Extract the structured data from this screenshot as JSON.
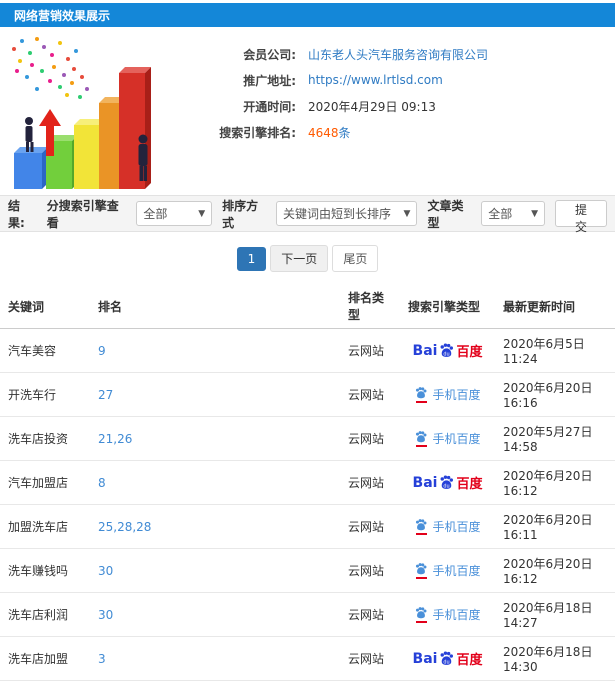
{
  "colors": {
    "header_bg": "#1487d8",
    "link_blue": "#2f7bc3",
    "rank_link_blue": "#418bd4",
    "count_orange": "#ff5a00",
    "baidu_blue": "#2540d8",
    "baidu_red": "#e2001a",
    "mobile_baidu_blue": "#4a90d9",
    "active_page_blue": "#2e75b5"
  },
  "header": {
    "title": "网络营销效果展示"
  },
  "info": {
    "rows": [
      {
        "label": "会员公司:",
        "value": "山东老人头汽车服务咨询有限公司"
      },
      {
        "label": "推广地址:",
        "value": "https://www.lrtlsd.com"
      },
      {
        "label": "开通时间:",
        "value": "2020年4月29日 09:13"
      },
      {
        "label": "搜索引擎排名:",
        "count": "4648",
        "unit": "条"
      }
    ]
  },
  "filters": {
    "result_label": "结果:",
    "engine_label": "分搜索引擎查看",
    "engine_value": "全部",
    "sort_label": "排序方式",
    "sort_value": "关键词由短到长排序",
    "article_label": "文章类型",
    "article_value": "全部",
    "submit_label": "提交"
  },
  "pagination": {
    "current": "1",
    "next": "下一页",
    "last": "尾页"
  },
  "table": {
    "columns": [
      "关键词",
      "排名",
      "排名类型",
      "搜索引擎类型",
      "最新更新时间"
    ],
    "rows": [
      {
        "keyword": "汽车美容",
        "rank": "9",
        "rank_type": "云网站",
        "engine": "百度",
        "updated": "2020年6月5日 11:24"
      },
      {
        "keyword": "开洗车行",
        "rank": "27",
        "rank_type": "云网站",
        "engine": "手机百度",
        "updated": "2020年6月20日 16:16"
      },
      {
        "keyword": "洗车店投资",
        "rank": "21,26",
        "rank_type": "云网站",
        "engine": "手机百度",
        "updated": "2020年5月27日 14:58"
      },
      {
        "keyword": "汽车加盟店",
        "rank": "8",
        "rank_type": "云网站",
        "engine": "百度",
        "updated": "2020年6月20日 16:12"
      },
      {
        "keyword": "加盟洗车店",
        "rank": "25,28,28",
        "rank_type": "云网站",
        "engine": "手机百度",
        "updated": "2020年6月20日 16:11"
      },
      {
        "keyword": "洗车赚钱吗",
        "rank": "30",
        "rank_type": "云网站",
        "engine": "手机百度",
        "updated": "2020年6月20日 16:12"
      },
      {
        "keyword": "洗车店利润",
        "rank": "30",
        "rank_type": "云网站",
        "engine": "手机百度",
        "updated": "2020年6月18日 14:27"
      },
      {
        "keyword": "洗车店加盟",
        "rank": "3",
        "rank_type": "云网站",
        "engine": "百度",
        "updated": "2020年6月18日 14:30"
      }
    ]
  },
  "engine_logos": {
    "baidu_latin": "Bai",
    "baidu_du": "du"
  }
}
